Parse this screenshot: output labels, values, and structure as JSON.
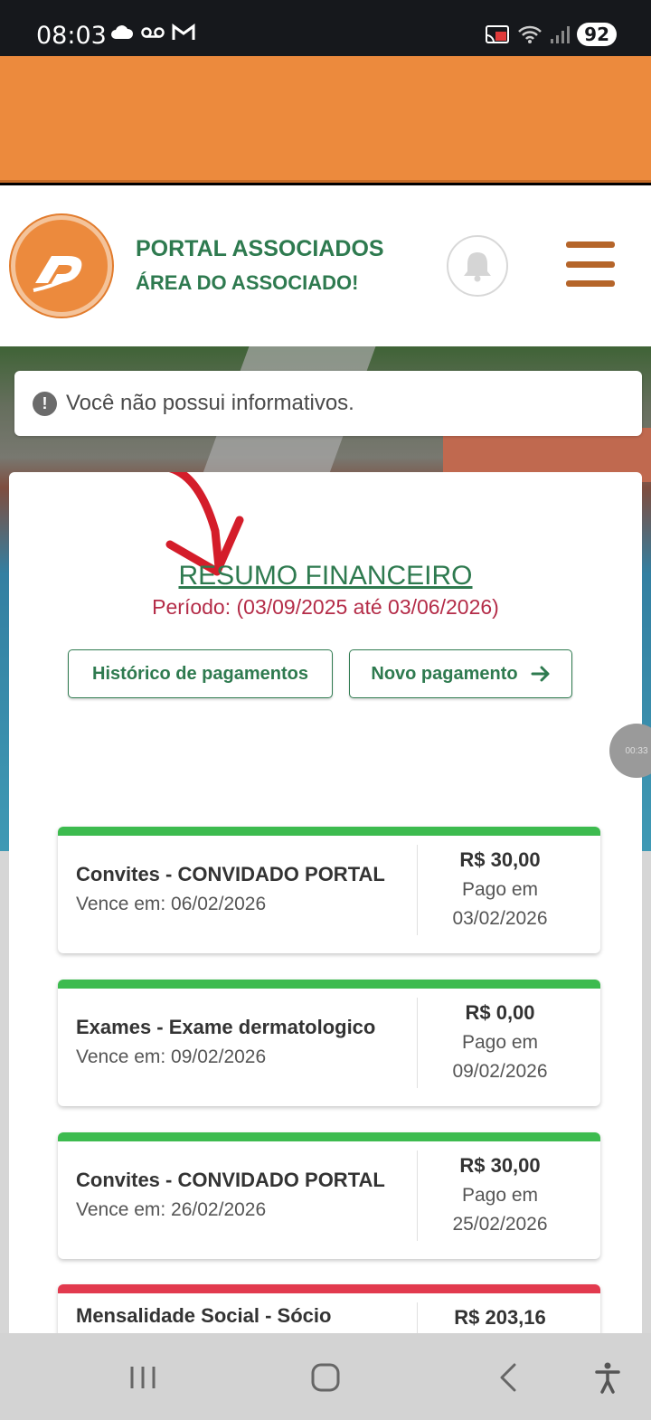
{
  "status_bar": {
    "time": "08:03",
    "battery": "92"
  },
  "header": {
    "title": "PORTAL ASSOCIADOS",
    "subtitle": "ÁREA DO ASSOCIADO!"
  },
  "notice": {
    "text": "Você não possui informativos."
  },
  "summary": {
    "title": "RESUMO FINANCEIRO",
    "period": "Período: (03/09/2025 até 03/06/2026)",
    "history_button": "Histórico de pagamentos",
    "new_payment_button": "Novo pagamento"
  },
  "side_bubble": "00:33",
  "payments": [
    {
      "name": "Convites - CONVIDADO PORTAL",
      "due": "Vence em: 06/02/2026",
      "amount": "R$ 30,00",
      "status": "Pago em",
      "paid_date": "03/02/2026",
      "strip_color": "#3dbb4f"
    },
    {
      "name": "Exames - Exame dermatologico",
      "due": "Vence em: 09/02/2026",
      "amount": "R$ 0,00",
      "status": "Pago em",
      "paid_date": "09/02/2026",
      "strip_color": "#3dbb4f"
    },
    {
      "name": "Convites - CONVIDADO PORTAL",
      "due": "Vence em: 26/02/2026",
      "amount": "R$ 30,00",
      "status": "Pago em",
      "paid_date": "25/02/2026",
      "strip_color": "#3dbb4f"
    },
    {
      "name": "Mensalidade Social - Sócio",
      "due": "",
      "amount": "R$ 203,16",
      "status": "",
      "paid_date": "",
      "strip_color": "#e23a4e"
    }
  ],
  "colors": {
    "brand_orange": "#ec8a3d",
    "brand_green": "#2e7a4f",
    "period_red": "#b42c48"
  },
  "icons": [
    "cloud-icon",
    "voicemail-icon",
    "gmail-icon",
    "cast-icon",
    "wifi-icon",
    "signal-icon",
    "bell-icon",
    "hamburger-menu-icon",
    "alert-circle-icon",
    "arrow-right-icon",
    "recents-icon",
    "home-icon",
    "back-icon",
    "accessibility-icon"
  ]
}
